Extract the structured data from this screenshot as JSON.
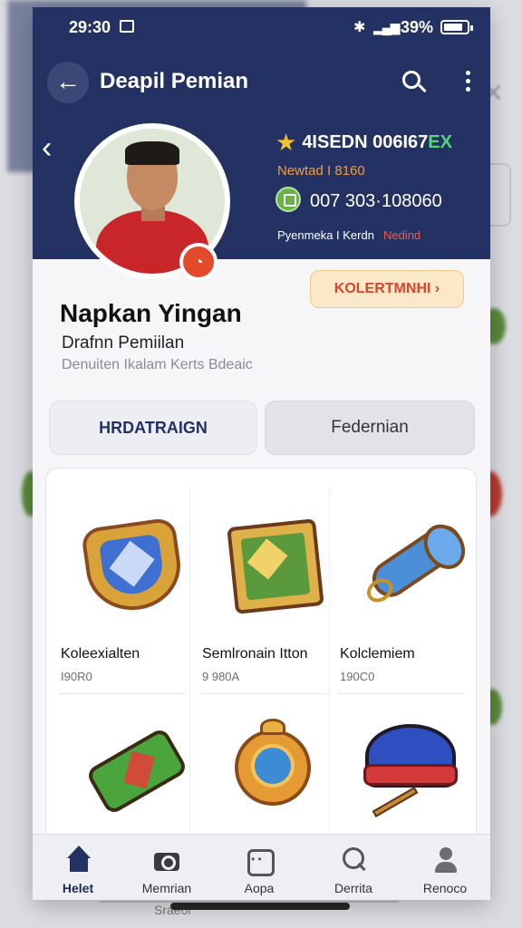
{
  "status_bar": {
    "time": "29:30",
    "battery": "39%"
  },
  "top_bar": {
    "title": "Deapil Pemian"
  },
  "profile": {
    "stat1": "4ISEDN 006I67",
    "stat1_accent": "EX",
    "stat1_sub": "Newtad I 8160",
    "stat2": "007 303·108060",
    "stat3": "Pyenmeka I Kerdn",
    "stat3_red": "Nedind",
    "collection_button": "KOLERTMNHI ›",
    "name": "Napkan Yingan",
    "subtitle": "Drafnn Pemiilan",
    "subtitle2": "Denuiten Ikalam Kerts Bdeaic"
  },
  "tabs": [
    {
      "label": "HRDATRAIGN"
    },
    {
      "label": "Federnian"
    }
  ],
  "items": [
    {
      "name": "Koleexialten",
      "code": "I90R0",
      "icon": "shield-icon"
    },
    {
      "name": "Semlronain Itton",
      "code": "9 980A",
      "icon": "frame-icon"
    },
    {
      "name": "Kolclemiem",
      "code": "190C0",
      "icon": "scroll-icon"
    },
    {
      "name": "",
      "code": "",
      "icon": "banner-icon"
    },
    {
      "name": "",
      "code": "",
      "icon": "orb-icon"
    },
    {
      "name": "",
      "code": "",
      "icon": "hat-icon"
    }
  ],
  "bottom_nav": [
    {
      "label": "Helet",
      "icon": "home-icon"
    },
    {
      "label": "Memrian",
      "icon": "camera-icon"
    },
    {
      "label": "Aopa",
      "icon": "gamepad-icon"
    },
    {
      "label": "Derrita",
      "icon": "search-icon"
    },
    {
      "label": "Renoco",
      "icon": "user-icon"
    }
  ],
  "background": {
    "footer_text": "Sraeol"
  },
  "colors": {
    "header": "#233262",
    "accent": "#e24a2a",
    "collection_bg": "#fbe8c9"
  }
}
